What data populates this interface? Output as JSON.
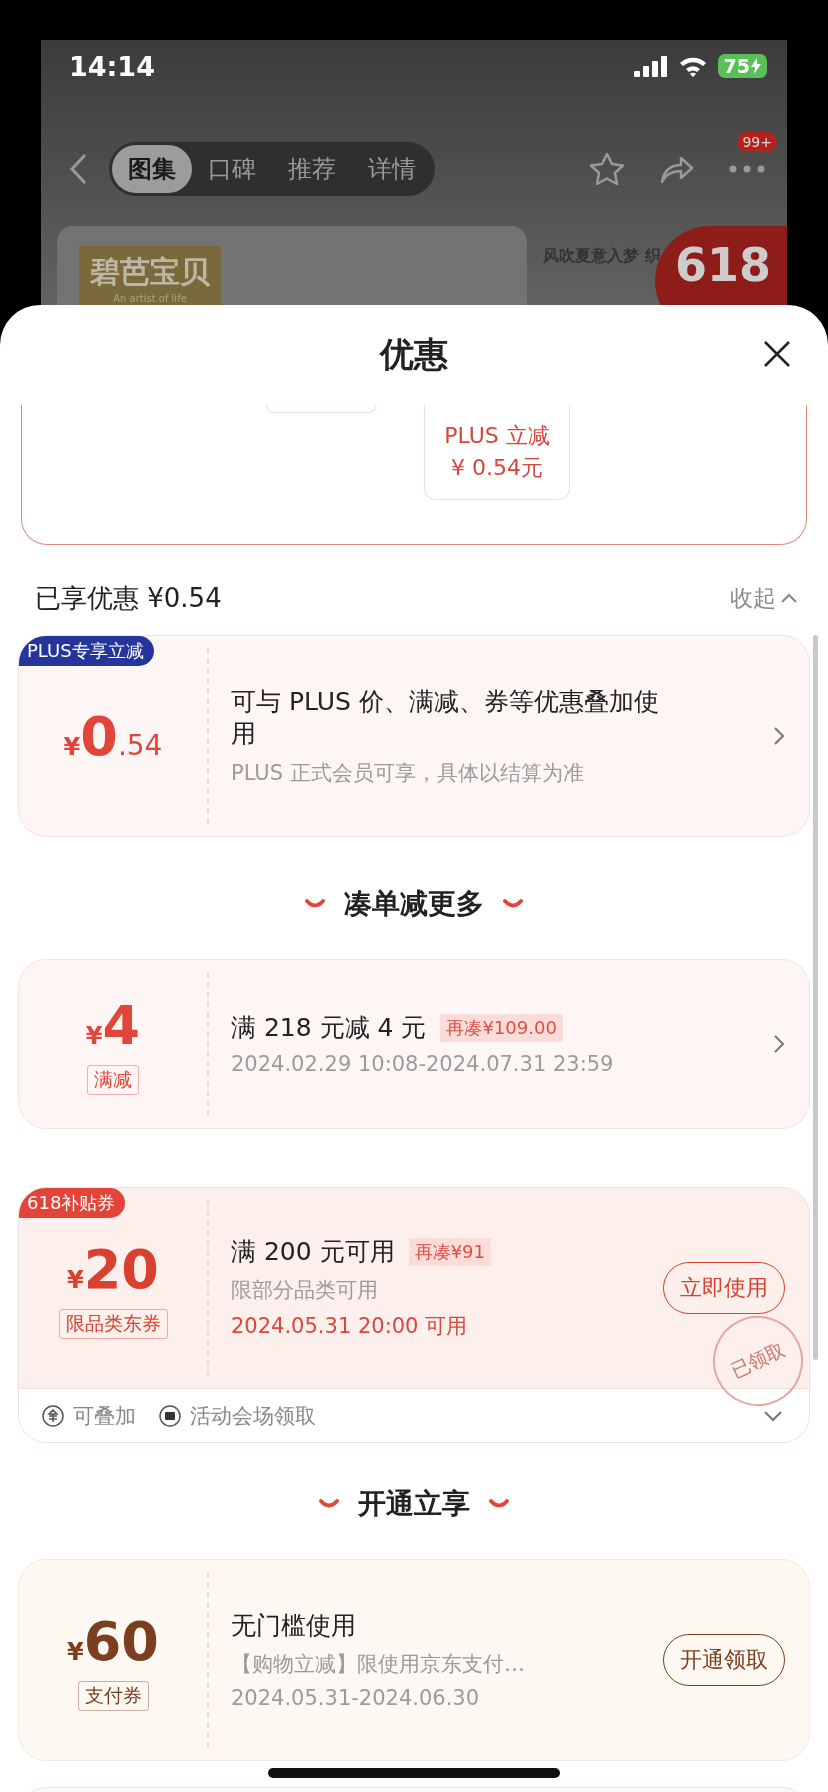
{
  "status_bar": {
    "time": "14:14",
    "battery": "75"
  },
  "nav": {
    "tabs": [
      {
        "label": "图集",
        "selected": true
      },
      {
        "label": "口碑",
        "selected": false
      },
      {
        "label": "推荐",
        "selected": false
      },
      {
        "label": "详情",
        "selected": false
      }
    ],
    "badge": "99+"
  },
  "banner": {
    "brand": "碧芭宝贝",
    "brand_tagline": "An artist of life",
    "promo_title": "风吹夏意入梦 织",
    "promo_badge": "618"
  },
  "sheet": {
    "title": "优惠"
  },
  "offer_tiles": [
    {
      "title": "PLUS 立减",
      "amount": "¥ 0.54元"
    }
  ],
  "savings": {
    "label": "已享优惠 ¥0.54",
    "toggle": "收起",
    "expanded": true
  },
  "applied": [
    {
      "kind": "plus",
      "tag": {
        "text": "PLUS专享立减",
        "color": "#26359b"
      },
      "currency": "¥",
      "amount": "0",
      "fraction": ".54",
      "title": "可与 PLUS 价、满减、券等优惠叠加使用",
      "lines": [
        {
          "text": "PLUS 正式会员可享，具体以结算为准",
          "kind": "muted"
        }
      ],
      "action": {
        "kind": "chevron"
      }
    }
  ],
  "sections": [
    {
      "title": "凑单减更多",
      "coupons": [
        {
          "kind": "discount",
          "currency": "¥",
          "amount": "4",
          "type_label": "满减",
          "title": "满 218 元减 4 元",
          "extra": "再凑¥109.00",
          "lines": [
            {
              "text": "2024.02.29 10:08-2024.07.31 23:59",
              "kind": "muted"
            }
          ],
          "action": {
            "kind": "chevron"
          }
        },
        {
          "kind": "subsidy",
          "tag": {
            "text": "618补贴券",
            "color": "#e3443a"
          },
          "currency": "¥",
          "amount": "20",
          "type_label": "限品类东券",
          "title": "满 200 元可用",
          "extra": "再凑¥91",
          "lines": [
            {
              "text": "限部分品类可用",
              "kind": "muted"
            },
            {
              "text": "2024.05.31 20:00 可用",
              "kind": "alert"
            }
          ],
          "action": {
            "kind": "button",
            "label": "立即使用"
          },
          "stamp": "已领取",
          "footer": [
            {
              "text": "可叠加"
            },
            {
              "text": "活动会场领取"
            }
          ],
          "expanded": false
        }
      ]
    },
    {
      "title": "开通立享",
      "coupons": [
        {
          "kind": "payment",
          "currency": "¥",
          "amount": "60",
          "type_label": "支付券",
          "title": "无门槛使用",
          "lines": [
            {
              "text": "【购物立减】限使用京东支付…",
              "kind": "muted"
            },
            {
              "text": "2024.05.31-2024.06.30",
              "kind": "muted"
            }
          ],
          "action": {
            "kind": "button",
            "label": "开通领取"
          }
        }
      ]
    }
  ]
}
